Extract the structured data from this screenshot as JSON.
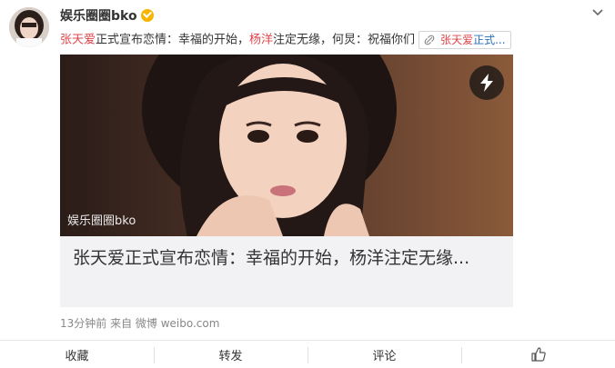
{
  "post": {
    "username": "娱乐圈圈bko",
    "text_parts": {
      "mention_1": "张天爱",
      "seg_1": "正式宣布恋情：幸福的开始，",
      "mention_2": "杨洋",
      "seg_2": "注定无缘，何炅：祝福你们"
    },
    "link_chip": {
      "part_a": "张天爱",
      "part_b": "正式..."
    },
    "card": {
      "watermark": "娱乐圈圈bko",
      "title": "张天爱正式宣布恋情：幸福的开始，杨洋注定无缘..."
    },
    "meta": "13分钟前 来自 微博 weibo.com"
  },
  "toolbar": {
    "favorite_label": "收藏",
    "repost_label": "转发",
    "comment_label": "评论"
  },
  "icons": [
    "avatar",
    "verified-badge",
    "chevron-down-icon",
    "link-icon",
    "lightning-icon",
    "thumbs-up-icon"
  ],
  "colors": {
    "highlight": "#e0454b",
    "link": "#2a6fbb",
    "card_bg": "#f2f2f5"
  }
}
